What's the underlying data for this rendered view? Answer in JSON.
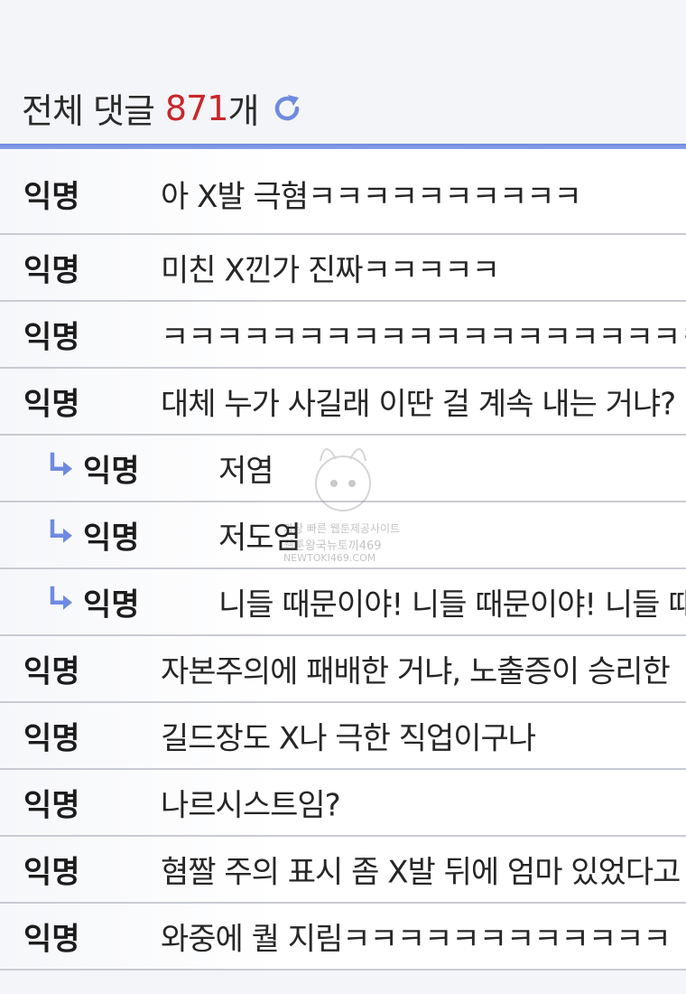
{
  "header": {
    "title_prefix": "전체 댓글",
    "count": "871",
    "title_suffix": "개",
    "refresh_icon": "refresh-icon",
    "accent_color": "#c8262b",
    "rule_color": "#6f8be0"
  },
  "comments": [
    {
      "author": "익명",
      "text": "아 X발 극혐ㅋㅋㅋㅋㅋㅋㅋㅋㅋㅋ",
      "reply": false
    },
    {
      "author": "익명",
      "text": "미친 X낀가 진짜ㅋㅋㅋㅋㅋ",
      "reply": false
    },
    {
      "author": "익명",
      "text": "ㅋㅋㅋㅋㅋㅋㅋㅋㅋㅋㅋㅋㅋㅋㅋㅋㅋㅋㅋㅋㅋㅋㅋㅋ",
      "reply": false
    },
    {
      "author": "익명",
      "text": "대체 누가 사길래 이딴 걸 계속 내는 거냐?",
      "reply": false
    },
    {
      "author": "익명",
      "text": "저염",
      "reply": true
    },
    {
      "author": "익명",
      "text": "저도염",
      "reply": true
    },
    {
      "author": "익명",
      "text": "니들 때문이야! 니들 때문이야!  니들 때",
      "reply": true
    },
    {
      "author": "익명",
      "text": "자본주의에 패배한 거냐, 노출증이 승리한",
      "reply": false
    },
    {
      "author": "익명",
      "text": "길드장도 X나 극한 직업이구나",
      "reply": false
    },
    {
      "author": "익명",
      "text": "나르시스트임?",
      "reply": false
    },
    {
      "author": "익명",
      "text": "혐짤 주의 표시 좀 X발 뒤에 엄마 있었다고",
      "reply": false
    },
    {
      "author": "익명",
      "text": "와중에 퀄 지림ㅋㅋㅋㅋㅋㅋㅋㅋㅋㅋㅋㅋ",
      "reply": false
    }
  ],
  "watermark": {
    "line1": "가장 빠른 웹툰제공사이트",
    "line2": "웹툰왕국뉴토끼469",
    "line3": "NEWTOKI469.COM"
  }
}
